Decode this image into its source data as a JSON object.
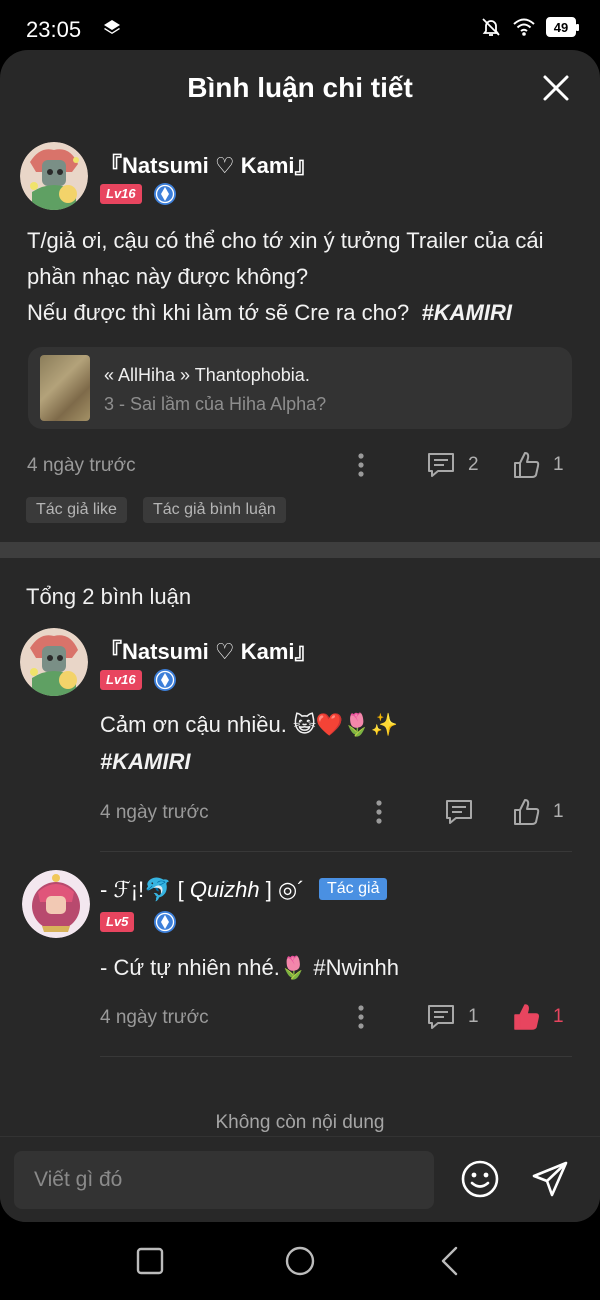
{
  "status_bar": {
    "time": "23:05",
    "battery": "49"
  },
  "header": {
    "title": "Bình luận chi tiết"
  },
  "main_comment": {
    "user_name": "『Natsumi ♡ Kami』",
    "level": "Lv16",
    "line1": "T/giả ơi, cậu có thể cho tớ xin ý tưởng Trailer của cái",
    "line2": "phần nhạc này được không?",
    "line3_prefix": "Nếu được thì khi làm tớ sẽ Cre ra cho?",
    "hashtag": "#KAMIRI",
    "link_title": "« AllHiha » Thantophobia.",
    "link_subtitle": "3 - Sai lầm của Hiha Alpha?",
    "time": "4 ngày trước",
    "comment_count": "2",
    "like_count": "1",
    "chip1": "Tác giả like",
    "chip2": "Tác giả bình luận"
  },
  "total_label": "Tổng 2 bình luận",
  "replies": [
    {
      "user_name": "『Natsumi ♡ Kami』",
      "level": "Lv16",
      "line1": "Cảm ơn cậu nhiều. 😺❤️🌷✨",
      "hashtag": "#KAMIRI",
      "time": "4 ngày trước",
      "like_count": "1"
    },
    {
      "user_name_prefix": "- ℱ¡!🐬 [ ",
      "user_name_italic": "Quizhh",
      "user_name_suffix": " ] ◎´",
      "author_tag": "Tác giả",
      "level": "Lv5",
      "line1": "- Cứ tự nhiên nhé.🌷 #Nwinhh",
      "time": "4 ngày trước",
      "comment_count": "1",
      "like_count": "1"
    }
  ],
  "end_text": "Không còn nội dung",
  "input": {
    "placeholder": "Viết gì đó"
  },
  "colors": {
    "accent_like": "#e8455f",
    "author_tag": "#4a90e2",
    "diamond": "#3d7fd9"
  }
}
